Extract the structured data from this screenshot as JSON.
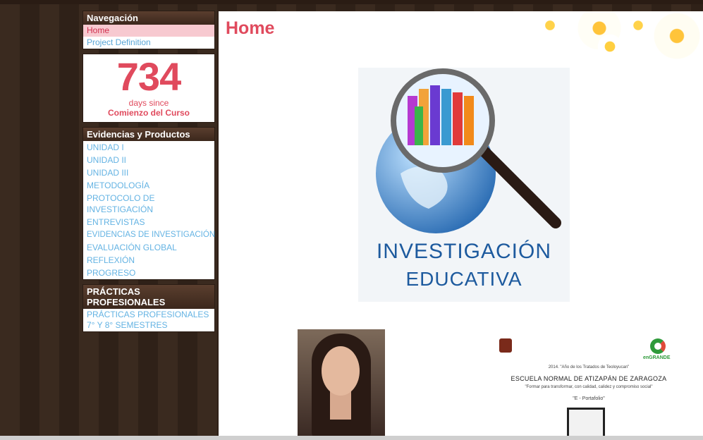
{
  "navegacion": {
    "title": "Navegación",
    "items": [
      {
        "label": "Home",
        "active": true
      },
      {
        "label": "Project Definition",
        "active": false
      }
    ]
  },
  "counter": {
    "value": "734",
    "line1": "days since",
    "line2": "Comienzo del Curso"
  },
  "evidencias": {
    "title": "Evidencias y Productos",
    "items": [
      {
        "label": "UNIDAD I"
      },
      {
        "label": "UNIDAD II"
      },
      {
        "label": "UNIDAD III"
      },
      {
        "label": "METODOLOGÍA"
      },
      {
        "label": "PROTOCOLO DE INVESTIGACIÓN"
      },
      {
        "label": "ENTREVISTAS"
      },
      {
        "label": "EVIDENCIAS DE INVESTIGACIÓN"
      },
      {
        "label": "EVALUACIÓN GLOBAL"
      },
      {
        "label": "REFLEXIÓN"
      },
      {
        "label": "PROGRESO"
      }
    ]
  },
  "practicas": {
    "title": "PRÁCTICAS PROFESIONALES",
    "items": [
      {
        "label": "PRÁCTICAS PROFESIONALES 7° Y 8° SEMESTRES"
      }
    ]
  },
  "main": {
    "title": "Home",
    "hero": {
      "line1": "INVESTIGACIÓN",
      "line2": "EDUCATIVA"
    },
    "doc": {
      "year_line": "2014. \"Año de los Tratados de Teoloyucan\"",
      "school": "ESCUELA NORMAL DE ATIZAPÁN DE ZARAGOZA",
      "motto": "\"Formar para transformar, con calidad, calidez y compromiso social\"",
      "portfolio": "\"E - Portafolio\"",
      "logo_right": "enGRANDE"
    }
  },
  "colors": {
    "accent": "#e04a5d",
    "link": "#64b3e3",
    "header_brown": "#3b271c"
  }
}
